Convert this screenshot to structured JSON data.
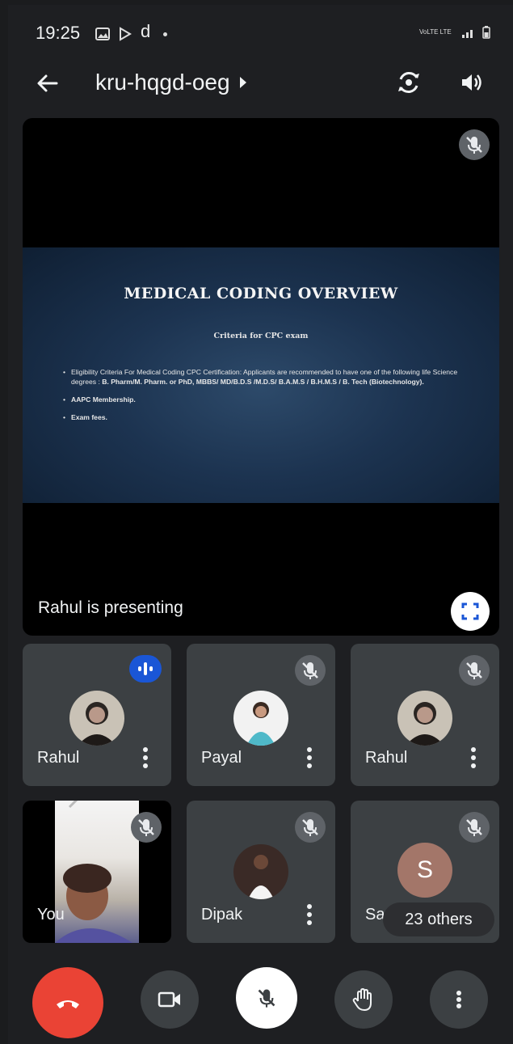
{
  "status_bar": {
    "time": "19:25",
    "app_letter": "d",
    "network": "VoLTE LTE"
  },
  "header": {
    "meeting_code": "kru-hqgd-oeg"
  },
  "presentation": {
    "slide_title": "MEDICAL CODING OVERVIEW",
    "slide_subtitle": "Criteria for CPC exam",
    "bullet1_text": "Eligibility Criteria For Medical Coding CPC Certification: Applicants are recommended to have one of the following life Science degrees : ",
    "bullet1_bold": "B. Pharm/M. Pharm. or PhD, MBBS/ MD/B.D.S /M.D.S/ B.A.M.S / B.H.M.S / B. Tech (Biotechnology).",
    "bullet2": "AAPC Membership.",
    "bullet3": "Exam fees.",
    "presenter_label": "Rahul is presenting"
  },
  "participants": [
    {
      "name": "Rahul",
      "state": "speaking"
    },
    {
      "name": "Payal",
      "state": "muted"
    },
    {
      "name": "Rahul",
      "state": "muted"
    },
    {
      "name": "You",
      "state": "muted"
    },
    {
      "name": "Dipak",
      "state": "muted"
    },
    {
      "name": "Sa",
      "state": "muted",
      "avatar_letter": "S",
      "others_label": "23 others"
    }
  ],
  "colors": {
    "end_call": "#ea4335",
    "speaking": "#1a56d6",
    "tile": "#3c4043",
    "background": "#1e1f22"
  }
}
